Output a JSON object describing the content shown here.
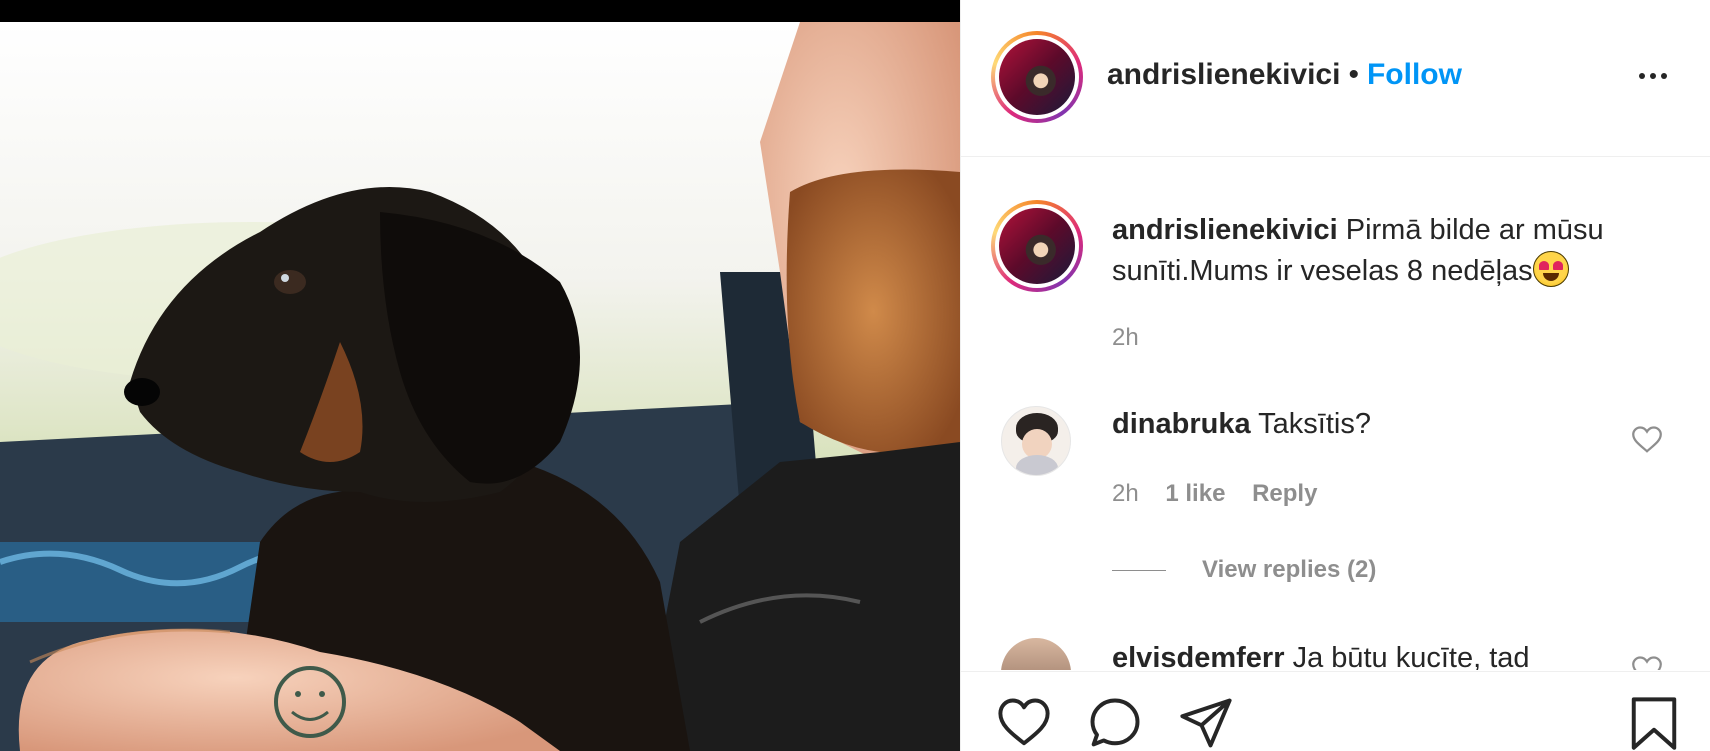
{
  "post": {
    "username": "andrislienekivici",
    "follow_label": "Follow",
    "separator": "•",
    "caption": {
      "username": "andrislienekivici",
      "text": "Pirmā bilde ar mūsu sunīti.Mums ir veselas 8 nedēļas",
      "emoji": "heart-eyes-emoji",
      "time": "2h"
    }
  },
  "comments": [
    {
      "username": "dinabruka",
      "text": "Taksītis?",
      "time": "2h",
      "likes": "1 like",
      "reply_label": "Reply",
      "view_replies": "View replies (2)"
    },
    {
      "username": "elvisdemferr",
      "text": "Ja būtu kucīte, tad"
    }
  ],
  "icons": {
    "more": "more-options-icon",
    "like": "heart-icon",
    "comment": "comment-icon",
    "share": "share-icon",
    "save": "bookmark-icon"
  },
  "colors": {
    "accent": "#0095f6",
    "text": "#262626",
    "muted": "#8e8e8e",
    "border": "#efefef"
  }
}
